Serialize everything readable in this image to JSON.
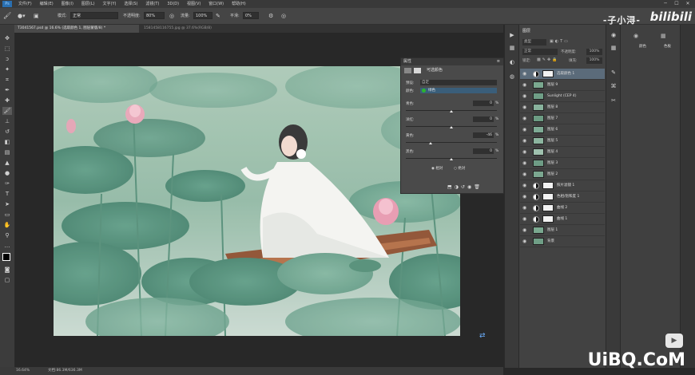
{
  "menu": {
    "items": [
      "文件(F)",
      "编辑(E)",
      "图像(I)",
      "图层(L)",
      "文字(Y)",
      "选择(S)",
      "滤镜(T)",
      "3D(D)",
      "视图(V)",
      "窗口(W)",
      "帮助(H)"
    ]
  },
  "options_bar": {
    "mode_label": "模式:",
    "mode_value": "正常",
    "opacity_label": "不透明度:",
    "opacity_value": "80%",
    "flow_label": "流量:",
    "flow_value": "100%",
    "smooth_label": "平滑:",
    "smooth_value": "0%"
  },
  "tabs": [
    {
      "label": "T3041567.psd @ 16.6% (选取颜色 1, 图层蒙版/8) *",
      "active": true
    },
    {
      "label": "1581458116755.jpg @ 37.6%(RGB/8)",
      "active": false
    }
  ],
  "status": {
    "zoom": "16.64%",
    "doc": "文档:86.3M/636.3M"
  },
  "properties": {
    "title": "属性",
    "subtitle": "可选颜色",
    "preset_label": "预设:",
    "preset_value": "自定",
    "colors_label": "颜色:",
    "colors_value": "绿色",
    "sliders": [
      {
        "label": "青色:",
        "value": "0",
        "pos": 0.5
      },
      {
        "label": "洋红:",
        "value": "0",
        "pos": 0.5
      },
      {
        "label": "黄色:",
        "value": "-46",
        "pos": 0.27
      },
      {
        "label": "黑色:",
        "value": "0",
        "pos": 0.5
      }
    ],
    "method_relative": "相对",
    "method_absolute": "绝对",
    "percent": "%"
  },
  "layers_panel": {
    "tab": "图层",
    "kind_label": "类型",
    "blend": "正常",
    "opacity_label": "不透明度:",
    "opacity_value": "100%",
    "lock_label": "锁定:",
    "fill_label": "填充:",
    "fill_value": "100%",
    "layers": [
      {
        "name": "选取颜色 1",
        "type": "adjust",
        "active": true
      },
      {
        "name": "图层 9",
        "type": "pixel"
      },
      {
        "name": "Sunlight (CEP 4)",
        "type": "pixel"
      },
      {
        "name": "图层 8",
        "type": "pixel"
      },
      {
        "name": "图层 7",
        "type": "pixel"
      },
      {
        "name": "图层 6",
        "type": "pixel"
      },
      {
        "name": "图层 5",
        "type": "pixel"
      },
      {
        "name": "图层 4",
        "type": "pixel"
      },
      {
        "name": "图层 3",
        "type": "pixel"
      },
      {
        "name": "图层 2",
        "type": "pixel"
      },
      {
        "name": "照片滤镜 1",
        "type": "adjust"
      },
      {
        "name": "色相/饱和度 1",
        "type": "adjust"
      },
      {
        "name": "曲线 2",
        "type": "adjust"
      },
      {
        "name": "曲线 1",
        "type": "adjust"
      },
      {
        "name": "图层 1",
        "type": "pixel"
      },
      {
        "name": "背景",
        "type": "pixel"
      }
    ]
  },
  "right_panel": {
    "items": [
      "颜色",
      "色板"
    ]
  },
  "watermarks": {
    "author": "-子小浔-",
    "site": "bilibili",
    "corner": "UiBQ.CoM"
  },
  "colors": {
    "accent": "#2a6fb0",
    "panel": "#424242",
    "selected_layer": "#5b6b7a"
  }
}
